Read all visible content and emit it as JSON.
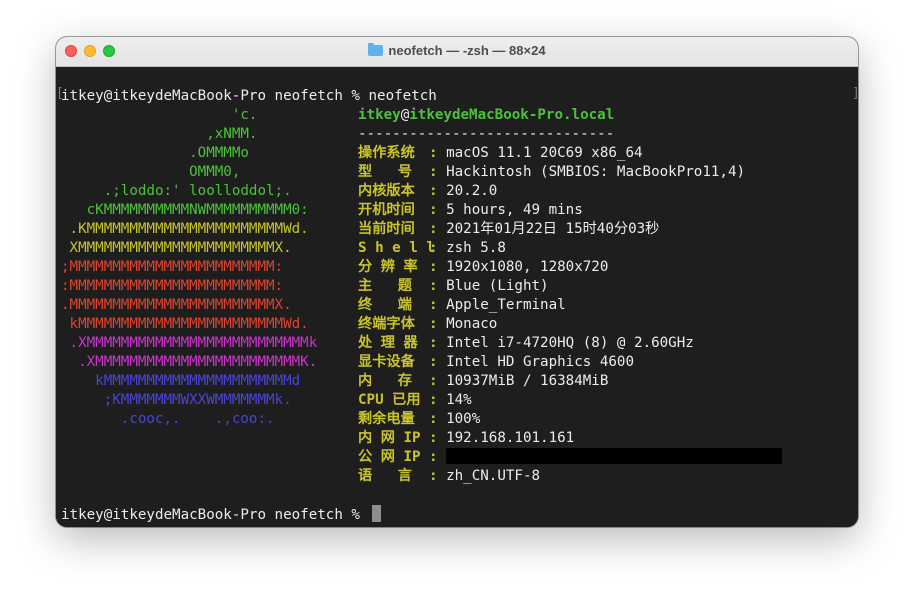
{
  "window": {
    "title": "neofetch — -zsh — 88×24"
  },
  "prompt": {
    "command_line": "itkey@itkeydeMacBook-Pro neofetch % neofetch",
    "final_prompt": "itkey@itkeydeMacBook-Pro neofetch % "
  },
  "art": {
    "lines": [
      {
        "text": "                    'c.",
        "color": "#4cc23a"
      },
      {
        "text": "                 ,xNMM.",
        "color": "#4cc23a"
      },
      {
        "text": "               .OMMMMo",
        "color": "#4cc23a"
      },
      {
        "text": "               OMMM0,",
        "color": "#4cc23a"
      },
      {
        "text": "     .;loddo:' loolloddol;.",
        "color": "#4cc23a"
      },
      {
        "text": "   cKMMMMMMMMMMNWMMMMMMMMMM0:",
        "color": "#4cc23a"
      },
      {
        "text": " .KMMMMMMMMMMMMMMMMMMMMMMMWd.",
        "color": "#c8c42a"
      },
      {
        "text": " XMMMMMMMMMMMMMMMMMMMMMMMX.",
        "color": "#c8c42a"
      },
      {
        "text": ";MMMMMMMMMMMMMMMMMMMMMMMM:",
        "color": "#e0432f"
      },
      {
        "text": ":MMMMMMMMMMMMMMMMMMMMMMMM:",
        "color": "#e0432f"
      },
      {
        "text": ".MMMMMMMMMMMMMMMMMMMMMMMMX.",
        "color": "#e0432f"
      },
      {
        "text": " kMMMMMMMMMMMMMMMMMMMMMMMMWd.",
        "color": "#e0432f"
      },
      {
        "text": " .XMMMMMMMMMMMMMMMMMMMMMMMMMMk",
        "color": "#cc34cc"
      },
      {
        "text": "  .XMMMMMMMMMMMMMMMMMMMMMMMMK.",
        "color": "#cc34cc"
      },
      {
        "text": "    kMMMMMMMMMMMMMMMMMMMMMMd",
        "color": "#4a44d6"
      },
      {
        "text": "     ;KMMMMMMMWXXWMMMMMMMk.",
        "color": "#4a44d6"
      },
      {
        "text": "       .cooc,.    .,coo:.",
        "color": "#4a44d6"
      }
    ]
  },
  "info": {
    "user": "itkey",
    "at": "@",
    "host": "itkeydeMacBook-Pro.local",
    "separator": "------------------------------",
    "rows": [
      {
        "label": "操作系统",
        "value": "macOS 11.1 20C69 x86_64"
      },
      {
        "label": "型   号",
        "value": "Hackintosh (SMBIOS: MacBookPro11,4)"
      },
      {
        "label": "内核版本",
        "value": "20.2.0"
      },
      {
        "label": "开机时间",
        "value": "5 hours, 49 mins"
      },
      {
        "label": "当前时间",
        "value": "2021年01月22日 15时40分03秒"
      },
      {
        "label": "S h e l l",
        "value": "zsh 5.8"
      },
      {
        "label": "分 辨 率",
        "value": "1920x1080, 1280x720"
      },
      {
        "label": "主   题",
        "value": "Blue (Light)"
      },
      {
        "label": "终   端",
        "value": "Apple_Terminal"
      },
      {
        "label": "终端字体",
        "value": "Monaco"
      },
      {
        "label": "处 理 器",
        "value": "Intel i7-4720HQ (8) @ 2.60GHz"
      },
      {
        "label": "显卡设备",
        "value": "Intel HD Graphics 4600"
      },
      {
        "label": "内   存",
        "value": "10937MiB / 16384MiB"
      },
      {
        "label": "CPU 已用",
        "value": "14%"
      },
      {
        "label": "剩余电量",
        "value": "100%"
      },
      {
        "label": "内 网 IP",
        "value": "192.168.101.161"
      },
      {
        "label": "公 网 IP",
        "value": "",
        "redacted": true
      },
      {
        "label": "语   言",
        "value": "zh_CN.UTF-8"
      }
    ]
  }
}
